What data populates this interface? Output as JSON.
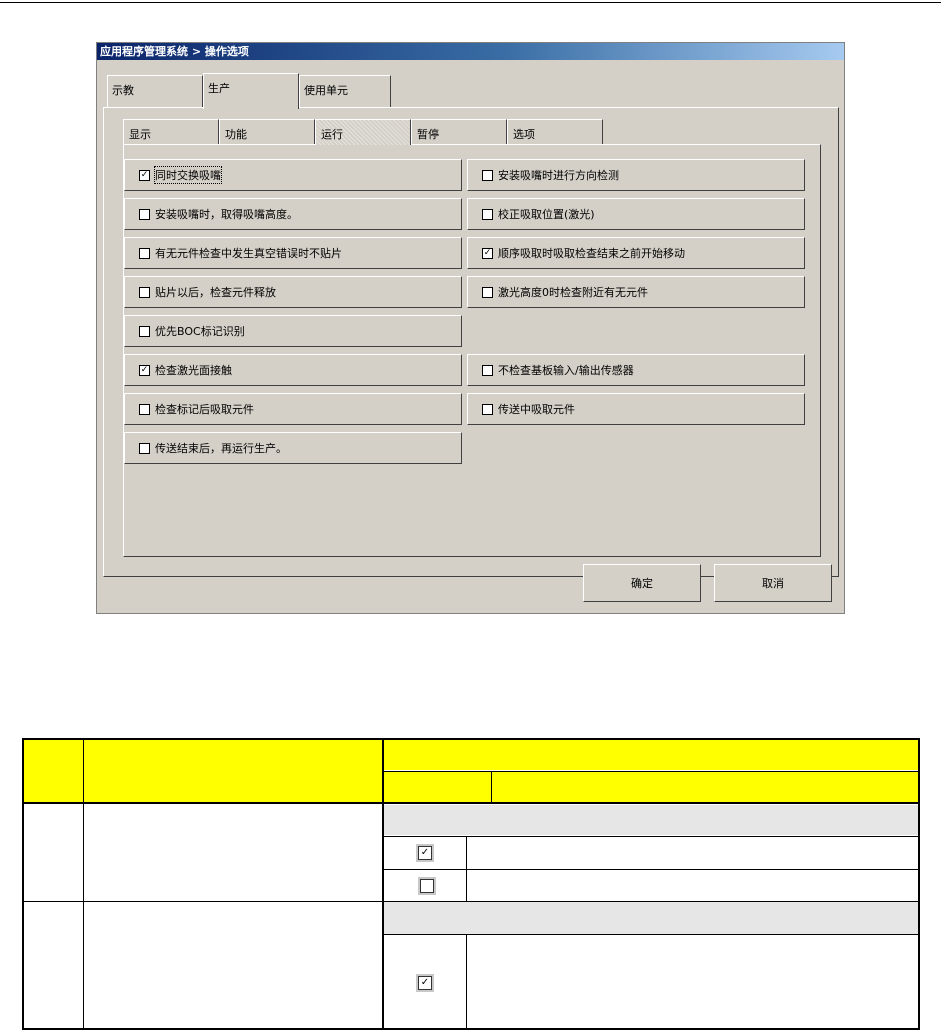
{
  "window": {
    "title": "应用程序管理系统 > 操作选项"
  },
  "top_tabs": [
    {
      "label": "示教"
    },
    {
      "label": "生产"
    },
    {
      "label": "使用单元"
    }
  ],
  "inner_tabs": [
    {
      "label": "显示"
    },
    {
      "label": "功能"
    },
    {
      "label": "运行"
    },
    {
      "label": "暂停"
    },
    {
      "label": "选项"
    }
  ],
  "options_left": [
    {
      "label": "同时交换吸嘴",
      "checked": "✓"
    },
    {
      "label": "安装吸嘴时，取得吸嘴高度。",
      "checked": ""
    },
    {
      "label": "有无元件检查中发生真空错误时不贴片",
      "checked": ""
    },
    {
      "label": "贴片以后，检查元件释放",
      "checked": ""
    },
    {
      "label": "优先BOC标记识别",
      "checked": ""
    },
    {
      "label": "检查激光面接触",
      "checked": "✓"
    },
    {
      "label": "检查标记后吸取元件",
      "checked": ""
    },
    {
      "label": "传送结束后，再运行生产。",
      "checked": ""
    }
  ],
  "options_right": [
    {
      "label": "安装吸嘴时进行方向检测",
      "checked": ""
    },
    {
      "label": "校正吸取位置(激光)",
      "checked": ""
    },
    {
      "label": "顺序吸取时吸取检查结束之前开始移动",
      "checked": "✓"
    },
    {
      "label": "激光高度0时检查附近有无元件",
      "checked": ""
    },
    {
      "label": "不检查基板输入/输出传感器",
      "checked": ""
    },
    {
      "label": "传送中吸取元件",
      "checked": ""
    }
  ],
  "buttons": {
    "ok": "确定",
    "cancel": "取消"
  },
  "table": {
    "checked_mark": "✓"
  }
}
